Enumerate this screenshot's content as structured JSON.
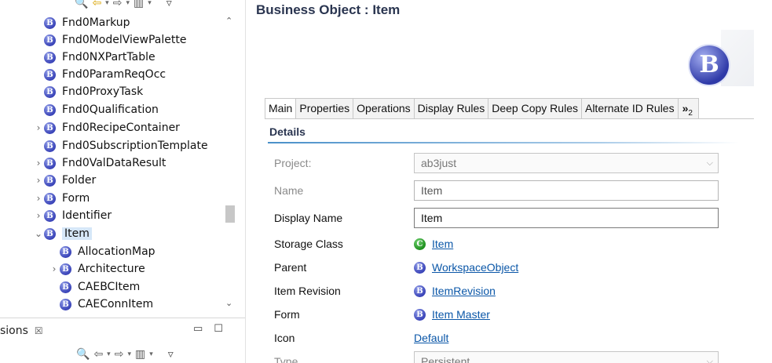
{
  "tree": {
    "items": [
      {
        "label": "Fnd0Markup",
        "expander": ""
      },
      {
        "label": "Fnd0ModelViewPalette",
        "expander": ""
      },
      {
        "label": "Fnd0NXPartTable",
        "expander": ""
      },
      {
        "label": "Fnd0ParamReqOcc",
        "expander": ""
      },
      {
        "label": "Fnd0ProxyTask",
        "expander": ""
      },
      {
        "label": "Fnd0Qualification",
        "expander": ""
      },
      {
        "label": "Fnd0RecipeContainer",
        "expander": "›"
      },
      {
        "label": "Fnd0SubscriptionTemplate",
        "expander": ""
      },
      {
        "label": "Fnd0ValDataResult",
        "expander": "›"
      },
      {
        "label": "Folder",
        "expander": "›"
      },
      {
        "label": "Form",
        "expander": "›"
      },
      {
        "label": "Identifier",
        "expander": "›"
      },
      {
        "label": "Item",
        "expander": "⌄"
      },
      {
        "label": "AllocationMap",
        "expander": ""
      },
      {
        "label": "Architecture",
        "expander": "›"
      },
      {
        "label": "CAEBCItem",
        "expander": ""
      },
      {
        "label": "CAEConnItem",
        "expander": ""
      }
    ]
  },
  "icons": {
    "business_object_glyph": "B",
    "class_glyph": "C",
    "search": "🔍",
    "back_arrow": "⇦",
    "forward_arrow": "⇨",
    "dropdown": "▾",
    "collapse_all": "▥",
    "view_menu": "▿",
    "close": "☒",
    "minimize": "▭",
    "maximize": "☐",
    "scroll_up": "⌃",
    "scroll_down": "⌄",
    "chevron_down": "⌵"
  },
  "panel2": {
    "tab_label": "sions"
  },
  "editor": {
    "title": "Business Object : Item",
    "logo_glyph": "B",
    "tabs": [
      "Main",
      "Properties",
      "Operations",
      "Display Rules",
      "Deep Copy Rules",
      "Alternate ID Rules"
    ],
    "more_tabs": {
      "symbol": "»",
      "count": "2"
    },
    "section_title": "Details",
    "fields": {
      "project": {
        "label": "Project:",
        "value": "ab3just"
      },
      "name": {
        "label": "Name",
        "value": "Item"
      },
      "display_name": {
        "label": "Display Name",
        "value": "Item"
      },
      "storage_class": {
        "label": "Storage Class",
        "value": "Item"
      },
      "parent": {
        "label": "Parent",
        "value": "WorkspaceObject"
      },
      "item_revision": {
        "label": "Item Revision",
        "value": "ItemRevision"
      },
      "form": {
        "label": "Form",
        "value": "Item Master"
      },
      "icon": {
        "label": "Icon",
        "value": "Default"
      },
      "type": {
        "label": "Type",
        "value": "Persistent"
      }
    }
  },
  "colors": {
    "bo_icon": "#3a44b8",
    "class_icon": "#1e8f1e",
    "link": "#0b57a8",
    "selection": "#d6e7f8",
    "title": "#2a3550"
  }
}
